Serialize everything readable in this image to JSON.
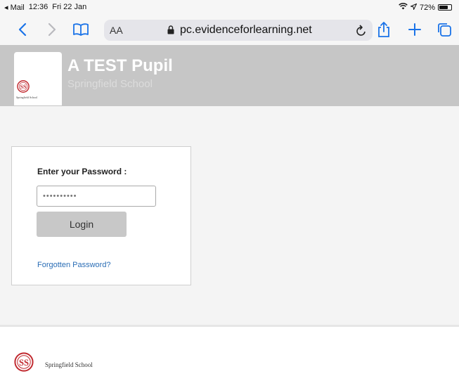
{
  "status_bar": {
    "back_app": "◂ Mail",
    "time": "12:36",
    "date": "Fri 22 Jan",
    "battery": "72%",
    "battery_level": 0.72
  },
  "browser": {
    "text_size_label": "AA",
    "url": "pc.evidenceforlearning.net"
  },
  "header": {
    "pupil_name": "A TEST Pupil",
    "school_name": "Springfield School",
    "logo_caption": "Springfield School"
  },
  "login": {
    "label": "Enter your Password :",
    "password_value": "••••••••••",
    "login_button": "Login",
    "forgot_link": "Forgotten Password?"
  },
  "footer": {
    "school_name": "Springfield School"
  },
  "colors": {
    "browser_accent": "#1a73e8",
    "header_bg": "#c6c6c6",
    "link": "#2a6db5",
    "logo_red": "#c0272d"
  }
}
